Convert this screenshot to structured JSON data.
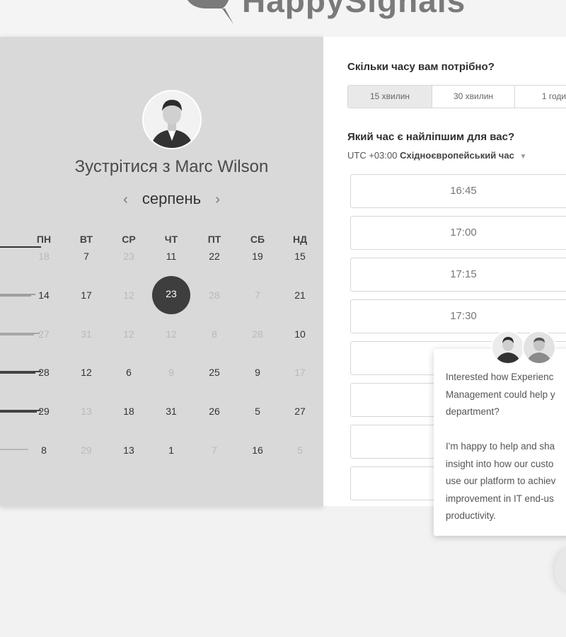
{
  "brand": {
    "name": "HappySignals"
  },
  "left": {
    "title_prefix": "Зустрітися з",
    "host_name": "Marc Wilson",
    "month": "серпень",
    "weekdays": [
      "ПН",
      "ВТ",
      "СР",
      "ЧТ",
      "ПТ",
      "СБ",
      "НД"
    ],
    "weeks": [
      [
        {
          "d": "18",
          "m": true
        },
        {
          "d": "7",
          "m": false
        },
        {
          "d": "23",
          "m": true
        },
        {
          "d": "11",
          "m": false
        },
        {
          "d": "22",
          "m": false
        },
        {
          "d": "19",
          "m": false
        },
        {
          "d": "15",
          "m": false
        }
      ],
      [
        {
          "d": "14",
          "m": false
        },
        {
          "d": "17",
          "m": false
        },
        {
          "d": "12",
          "m": true
        },
        {
          "d": "23",
          "m": false,
          "sel": true
        },
        {
          "d": "28",
          "m": true
        },
        {
          "d": "7",
          "m": true
        },
        {
          "d": "21",
          "m": false
        }
      ],
      [
        {
          "d": "27",
          "m": true
        },
        {
          "d": "31",
          "m": true
        },
        {
          "d": "12",
          "m": true
        },
        {
          "d": "12",
          "m": true
        },
        {
          "d": "8",
          "m": true
        },
        {
          "d": "28",
          "m": true
        },
        {
          "d": "10",
          "m": false
        }
      ],
      [
        {
          "d": "28",
          "m": false
        },
        {
          "d": "12",
          "m": false
        },
        {
          "d": "6",
          "m": false
        },
        {
          "d": "9",
          "m": true
        },
        {
          "d": "25",
          "m": false
        },
        {
          "d": "9",
          "m": false
        },
        {
          "d": "17",
          "m": true
        }
      ],
      [
        {
          "d": "29",
          "m": false
        },
        {
          "d": "13",
          "m": true
        },
        {
          "d": "18",
          "m": false
        },
        {
          "d": "31",
          "m": false
        },
        {
          "d": "26",
          "m": false
        },
        {
          "d": "5",
          "m": false
        },
        {
          "d": "27",
          "m": false
        }
      ],
      [
        {
          "d": "8",
          "m": false
        },
        {
          "d": "29",
          "m": true
        },
        {
          "d": "13",
          "m": false
        },
        {
          "d": "1",
          "m": false
        },
        {
          "d": "7",
          "m": true
        },
        {
          "d": "16",
          "m": false
        },
        {
          "d": "5",
          "m": true
        }
      ]
    ]
  },
  "right": {
    "duration_question": "Скільки часу вам потрібно?",
    "durations": [
      {
        "label": "15 хвилин",
        "active": true
      },
      {
        "label": "30 хвилин",
        "active": false
      },
      {
        "label": "1 годи",
        "active": false
      }
    ],
    "time_question": "Який час є найліпшим для вас?",
    "tz_offset": "UTC +03:00",
    "tz_name": "Східноєвропейський час",
    "slots": [
      "16:45",
      "17:00",
      "17:15",
      "17:30",
      "",
      "",
      "",
      ""
    ]
  },
  "chat": {
    "lines": [
      "Interested how Experienc",
      "Management could help y",
      "department?",
      "",
      "I'm happy to help and sha",
      "insight into how our custo",
      "use our platform to achiev",
      "improvement in IT end-us",
      "productivity."
    ]
  }
}
